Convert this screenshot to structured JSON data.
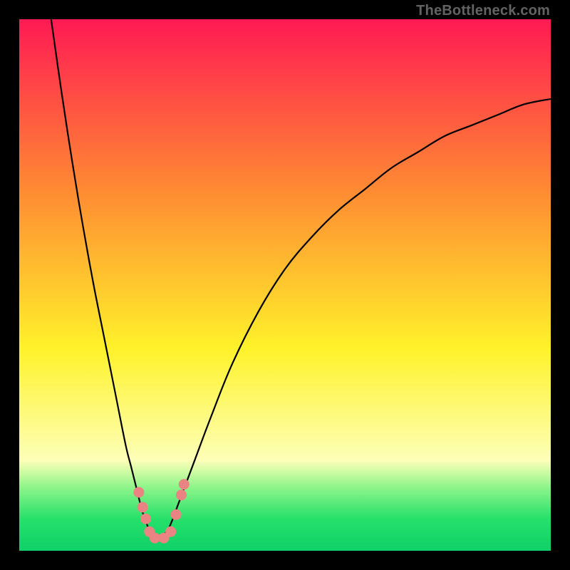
{
  "watermark": "TheBottleneck.com",
  "colors": {
    "top": "#ff1a53",
    "mid_orange": "#ff8a33",
    "yellow": "#fff22a",
    "pale_yellow": "#fdffb8",
    "green_top": "#8ff58a",
    "green_mid": "#26e06a",
    "green_bottom": "#0fd168",
    "curve": "#000000",
    "points": "#e98483",
    "frame": "#000000"
  },
  "chart_data": {
    "type": "line",
    "title": "",
    "xlabel": "",
    "ylabel": "",
    "xlim": [
      0,
      100
    ],
    "ylim": [
      0,
      100
    ],
    "curve_min_x": 26,
    "series": [
      {
        "name": "bottleneck-curve-left",
        "x": [
          6,
          8,
          10,
          12,
          14,
          16,
          18,
          20,
          21,
          22,
          23,
          24,
          25,
          26
        ],
        "y": [
          100,
          86,
          73,
          61,
          50,
          40,
          30,
          20,
          16,
          12,
          8,
          5,
          3,
          2
        ]
      },
      {
        "name": "bottleneck-curve-right",
        "x": [
          26,
          28,
          30,
          33,
          36,
          40,
          45,
          50,
          55,
          60,
          65,
          70,
          75,
          80,
          85,
          90,
          95,
          100
        ],
        "y": [
          2,
          4,
          9,
          17,
          25,
          35,
          45,
          53,
          59,
          64,
          68,
          72,
          75,
          78,
          80,
          82,
          84,
          85
        ]
      }
    ],
    "points": [
      {
        "x": 22.5,
        "y": 11.0
      },
      {
        "x": 23.2,
        "y": 8.2
      },
      {
        "x": 23.8,
        "y": 6.0
      },
      {
        "x": 24.5,
        "y": 3.6
      },
      {
        "x": 25.5,
        "y": 2.4
      },
      {
        "x": 27.2,
        "y": 2.4
      },
      {
        "x": 28.5,
        "y": 3.6
      },
      {
        "x": 29.5,
        "y": 6.8
      },
      {
        "x": 30.5,
        "y": 10.5
      },
      {
        "x": 31.0,
        "y": 12.5
      }
    ]
  }
}
